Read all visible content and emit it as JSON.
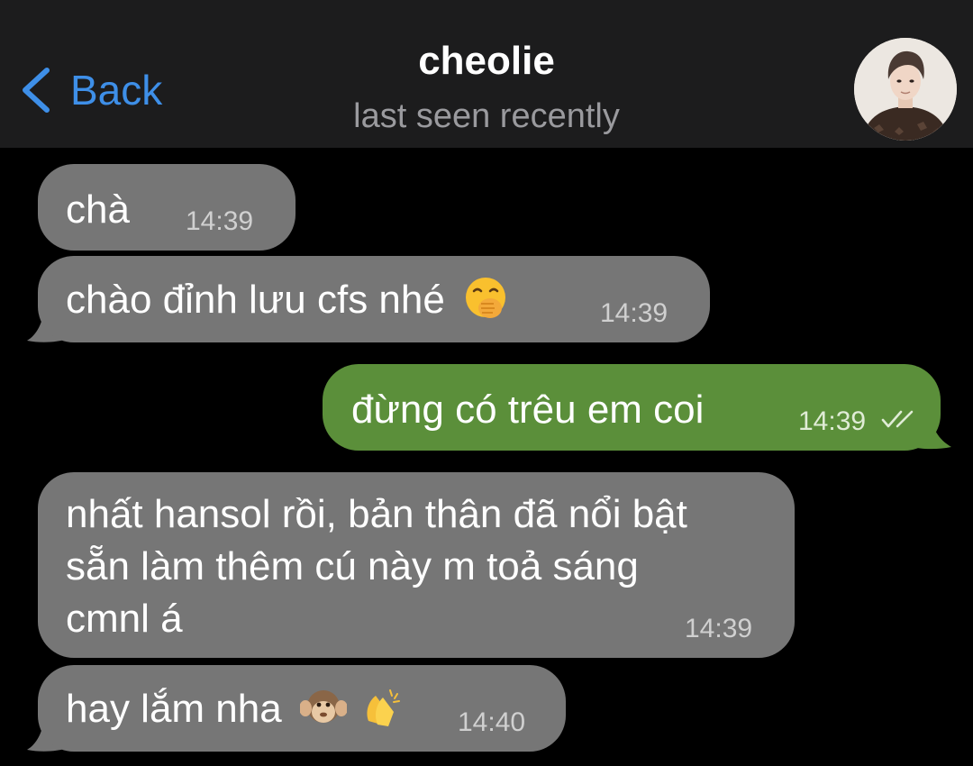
{
  "header": {
    "back_label": "Back",
    "title": "cheolie",
    "status": "last seen recently"
  },
  "messages": [
    {
      "direction": "incoming",
      "text": "chà",
      "time": "14:39"
    },
    {
      "direction": "incoming",
      "text": "chào đỉnh lưu cfs nhé",
      "emoji": [
        "face-with-hand-over-mouth-emoji"
      ],
      "time": "14:39"
    },
    {
      "direction": "outgoing",
      "text": "đừng có trêu em coi",
      "time": "14:39",
      "status": "read-double-check"
    },
    {
      "direction": "incoming",
      "lines": [
        "nhất hansol rồi, bản thân đã nổi bật",
        "sẵn làm thêm cú này m toả sáng",
        "cmnl á"
      ],
      "time": "14:39"
    },
    {
      "direction": "incoming",
      "text": "hay lắm nha",
      "emoji": [
        "hear-no-evil-monkey-emoji",
        "clapping-hands-emoji"
      ],
      "time": "14:40"
    }
  ],
  "colors": {
    "background": "#000000",
    "header": "#1c1c1d",
    "accent": "#3e8fe8",
    "incoming_bubble": "#767676",
    "outgoing_bubble": "#5b8f3a"
  },
  "icons": [
    "chevron-left-icon",
    "avatar",
    "double-check-icon"
  ]
}
